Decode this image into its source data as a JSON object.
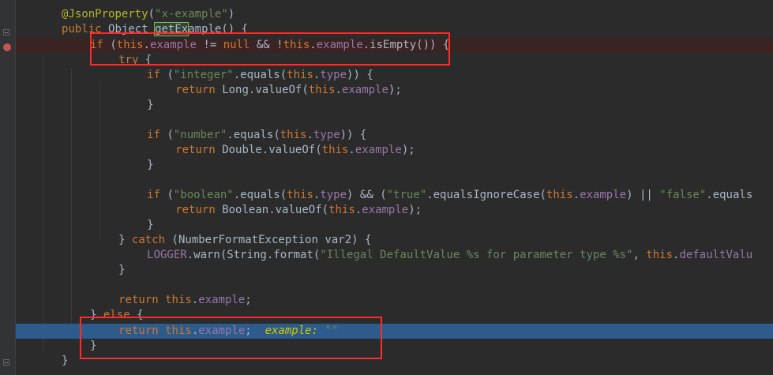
{
  "editor": {
    "lines": [
      {
        "parts": [
          [
            "ann",
            "@JsonProperty"
          ],
          [
            "pl",
            "("
          ],
          [
            "str",
            "\"x-example\""
          ],
          [
            "pl",
            ")"
          ]
        ]
      },
      {
        "parts": [
          [
            "kw",
            "public "
          ],
          [
            "pl",
            "Object "
          ],
          [
            "hl",
            "getEx"
          ],
          [
            "pl",
            "ample() {"
          ]
        ]
      },
      {
        "parts": [
          [
            "kw",
            "if "
          ],
          [
            "pl",
            "("
          ],
          [
            "kw",
            "this"
          ],
          [
            "pl",
            "."
          ],
          [
            "fld",
            "example"
          ],
          [
            "pl",
            " != "
          ],
          [
            "kw",
            "null"
          ],
          [
            "pl",
            " && !"
          ],
          [
            "kw",
            "this"
          ],
          [
            "pl",
            "."
          ],
          [
            "fld",
            "example"
          ],
          [
            "pl",
            ".isEmpty()) {"
          ]
        ]
      },
      {
        "parts": [
          [
            "kw",
            "try "
          ],
          [
            "pl",
            "{"
          ]
        ]
      },
      {
        "parts": [
          [
            "kw",
            "if "
          ],
          [
            "pl",
            "("
          ],
          [
            "str",
            "\"integer\""
          ],
          [
            "pl",
            ".equals("
          ],
          [
            "kw",
            "this"
          ],
          [
            "pl",
            "."
          ],
          [
            "fld",
            "type"
          ],
          [
            "pl",
            ")) {"
          ]
        ]
      },
      {
        "parts": [
          [
            "kw",
            "return "
          ],
          [
            "pl",
            "Long."
          ],
          [
            "pl",
            "valueOf("
          ],
          [
            "kw",
            "this"
          ],
          [
            "pl",
            "."
          ],
          [
            "fld",
            "example"
          ],
          [
            "pl",
            ");"
          ]
        ]
      },
      {
        "parts": [
          [
            "pl",
            "}"
          ]
        ]
      },
      {
        "parts": []
      },
      {
        "parts": [
          [
            "kw",
            "if "
          ],
          [
            "pl",
            "("
          ],
          [
            "str",
            "\"number\""
          ],
          [
            "pl",
            ".equals("
          ],
          [
            "kw",
            "this"
          ],
          [
            "pl",
            "."
          ],
          [
            "fld",
            "type"
          ],
          [
            "pl",
            ")) {"
          ]
        ]
      },
      {
        "parts": [
          [
            "kw",
            "return "
          ],
          [
            "pl",
            "Double."
          ],
          [
            "pl",
            "valueOf("
          ],
          [
            "kw",
            "this"
          ],
          [
            "pl",
            "."
          ],
          [
            "fld",
            "example"
          ],
          [
            "pl",
            ");"
          ]
        ]
      },
      {
        "parts": [
          [
            "pl",
            "}"
          ]
        ]
      },
      {
        "parts": []
      },
      {
        "parts": [
          [
            "kw",
            "if "
          ],
          [
            "pl",
            "("
          ],
          [
            "str",
            "\"boolean\""
          ],
          [
            "pl",
            ".equals("
          ],
          [
            "kw",
            "this"
          ],
          [
            "pl",
            "."
          ],
          [
            "fld",
            "type"
          ],
          [
            "pl",
            ") && ("
          ],
          [
            "str",
            "\"true\""
          ],
          [
            "pl",
            ".equalsIgnoreCase("
          ],
          [
            "kw",
            "this"
          ],
          [
            "pl",
            "."
          ],
          [
            "fld",
            "example"
          ],
          [
            "pl",
            ") || "
          ],
          [
            "str",
            "\"false\""
          ],
          [
            "pl",
            ".equals"
          ]
        ]
      },
      {
        "parts": [
          [
            "kw",
            "return "
          ],
          [
            "pl",
            "Boolean."
          ],
          [
            "pl",
            "valueOf("
          ],
          [
            "kw",
            "this"
          ],
          [
            "pl",
            "."
          ],
          [
            "fld",
            "example"
          ],
          [
            "pl",
            ");"
          ]
        ]
      },
      {
        "parts": [
          [
            "pl",
            "}"
          ]
        ]
      },
      {
        "parts": [
          [
            "pl",
            "} "
          ],
          [
            "kw",
            "catch "
          ],
          [
            "pl",
            "(NumberFormatException var2) {"
          ]
        ]
      },
      {
        "parts": [
          [
            "fld",
            "LOGGER"
          ],
          [
            "pl",
            ".warn(String."
          ],
          [
            "pl",
            "format("
          ],
          [
            "str",
            "\"Illegal DefaultValue %s for parameter type %s\""
          ],
          [
            "pl",
            ", "
          ],
          [
            "kw",
            "this"
          ],
          [
            "pl",
            "."
          ],
          [
            "fld",
            "defaultValu"
          ]
        ]
      },
      {
        "parts": [
          [
            "pl",
            "}"
          ]
        ]
      },
      {
        "parts": []
      },
      {
        "parts": [
          [
            "kw",
            "return this"
          ],
          [
            "pl",
            "."
          ],
          [
            "fld",
            "example"
          ],
          [
            "pl",
            ";"
          ]
        ]
      },
      {
        "parts": [
          [
            "pl",
            "} "
          ],
          [
            "kw",
            "else "
          ],
          [
            "pl",
            "{"
          ]
        ]
      },
      {
        "parts": [
          [
            "kw",
            "return this"
          ],
          [
            "pl",
            "."
          ],
          [
            "fld",
            "example"
          ],
          [
            "pl",
            ";  "
          ],
          [
            "dbg",
            "example: "
          ],
          [
            "str",
            "\"\""
          ]
        ]
      },
      {
        "parts": [
          [
            "pl",
            "}"
          ]
        ]
      },
      {
        "parts": [
          [
            "pl",
            "}"
          ]
        ]
      }
    ]
  },
  "colors": {
    "background": "#2b2b2b",
    "keyword": "#cc7832",
    "string": "#6a8759",
    "annotation": "#bbb529",
    "field": "#9876aa",
    "current_line": "#2d5b8c",
    "breakpoint_line": "#3a2323",
    "annotation_box": "#ff2a2a"
  }
}
